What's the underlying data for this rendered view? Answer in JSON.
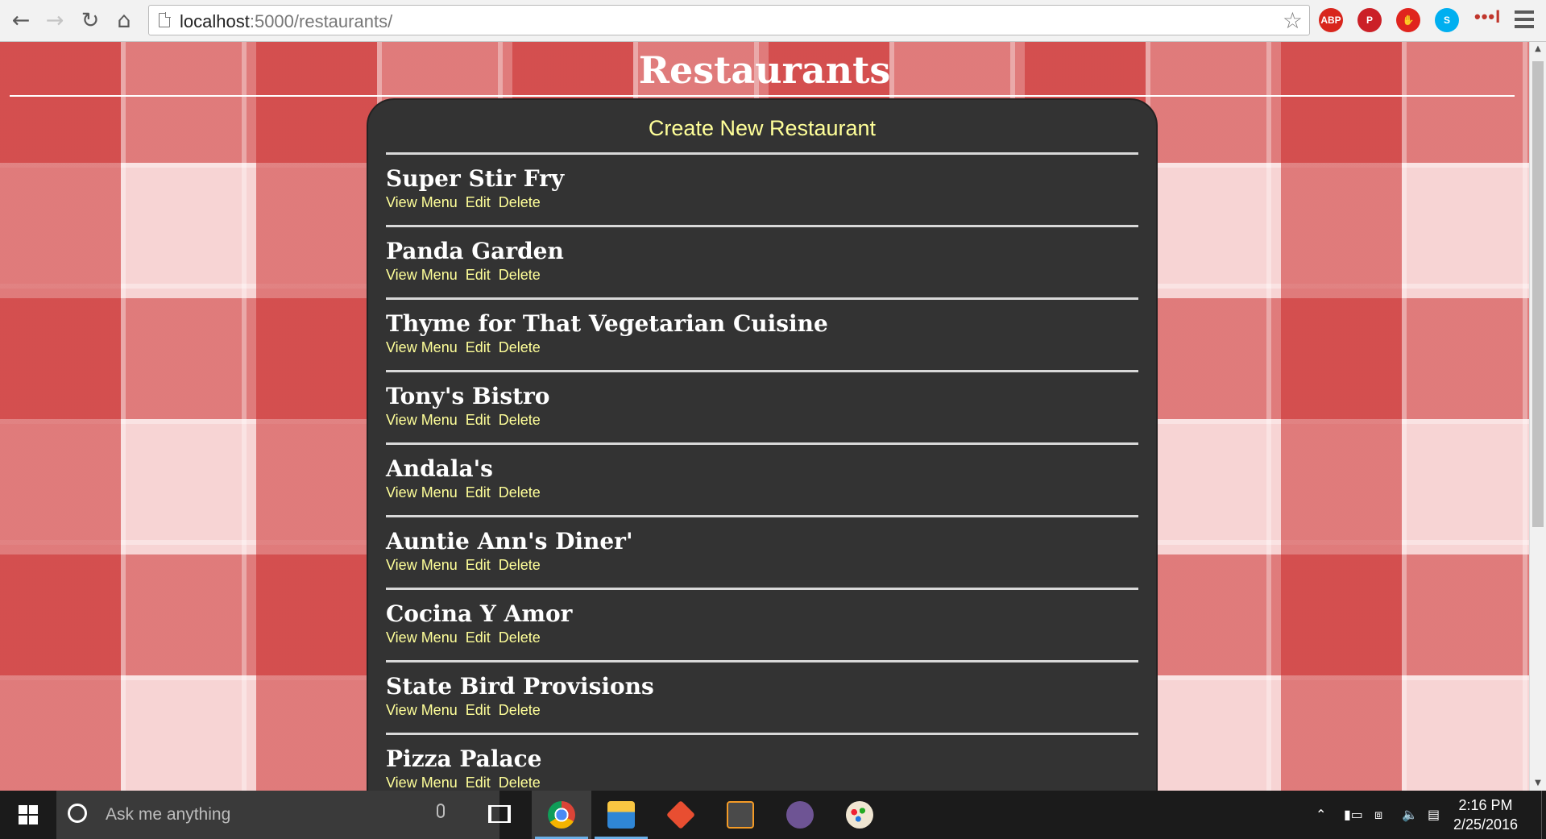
{
  "browser": {
    "url_host": "localhost",
    "url_rest": ":5000/restaurants/",
    "extensions": [
      {
        "name": "adblock-plus-icon",
        "label": "ABP",
        "color": "#d8261d"
      },
      {
        "name": "pinterest-icon",
        "label": "P",
        "color": "#cb2027"
      },
      {
        "name": "adblock-icon",
        "label": "✋",
        "color": "#e0241e"
      },
      {
        "name": "skype-icon",
        "label": "S",
        "color": "#00aff0"
      }
    ],
    "more_extensions": "•••I"
  },
  "page": {
    "heading": "Restaurants",
    "create_link": "Create New Restaurant",
    "action_labels": {
      "view": "View Menu",
      "edit": "Edit",
      "delete": "Delete"
    },
    "restaurants": [
      {
        "name": "Super Stir Fry"
      },
      {
        "name": "Panda Garden"
      },
      {
        "name": "Thyme for That Vegetarian Cuisine"
      },
      {
        "name": "Tony's Bistro"
      },
      {
        "name": "Andala's"
      },
      {
        "name": "Auntie Ann's Diner'"
      },
      {
        "name": "Cocina Y Amor"
      },
      {
        "name": "State Bird Provisions"
      },
      {
        "name": "Pizza Palace"
      }
    ]
  },
  "colors": {
    "panel_bg": "#333333",
    "link": "#ffff99",
    "tablecloth_red": "#c82323"
  },
  "taskbar": {
    "search_placeholder": "Ask me anything",
    "apps": [
      {
        "name": "chrome-icon",
        "active": true
      },
      {
        "name": "file-explorer-icon",
        "active": false
      },
      {
        "name": "git-icon",
        "active": false
      },
      {
        "name": "sublime-text-icon",
        "active": false
      },
      {
        "name": "github-icon",
        "active": false
      },
      {
        "name": "paint-icon",
        "active": false
      }
    ],
    "time": "2:16 PM",
    "date": "2/25/2016"
  }
}
